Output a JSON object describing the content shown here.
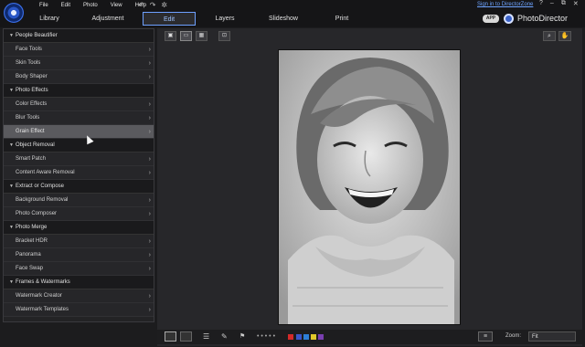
{
  "menu": [
    "File",
    "Edit",
    "Photo",
    "View",
    "Help"
  ],
  "quick_icons": [
    "undo-icon",
    "redo-icon",
    "settings-icon"
  ],
  "quick_glyphs": [
    "↶",
    "↷",
    "✲"
  ],
  "tabs": [
    "Library",
    "Adjustment",
    "Edit",
    "Layers",
    "Slideshow",
    "Print"
  ],
  "active_tab": "Edit",
  "signin_label": "Sign in to DirectorZone",
  "window_controls": [
    "?",
    "–",
    "⧉",
    "✕"
  ],
  "app_badge": "APP",
  "brand": "PhotoDirector",
  "panel": {
    "sections": [
      {
        "title": "People Beautifier",
        "items": [
          "Face Tools",
          "Skin Tools",
          "Body Shaper"
        ]
      },
      {
        "title": "Photo Effects",
        "items": [
          "Color Effects",
          "Blur Tools",
          "Grain Effect"
        ]
      },
      {
        "title": "Object Removal",
        "items": [
          "Smart Patch",
          "Content Aware Removal"
        ]
      },
      {
        "title": "Extract or Compose",
        "items": [
          "Background Removal",
          "Photo Composer"
        ]
      },
      {
        "title": "Photo Merge",
        "items": [
          "Bracket HDR",
          "Panorama",
          "Face Swap"
        ]
      },
      {
        "title": "Frames & Watermarks",
        "items": [
          "Watermark Creator",
          "Watermark Templates"
        ]
      }
    ],
    "hover_item": "Grain Effect"
  },
  "swatch_colors": [
    "#d42a2a",
    "#3b56c9",
    "#2d7fd8",
    "#e0c82a",
    "#7a3fb0"
  ],
  "zoom_label": "Zoom:",
  "zoom_value": "Fit"
}
